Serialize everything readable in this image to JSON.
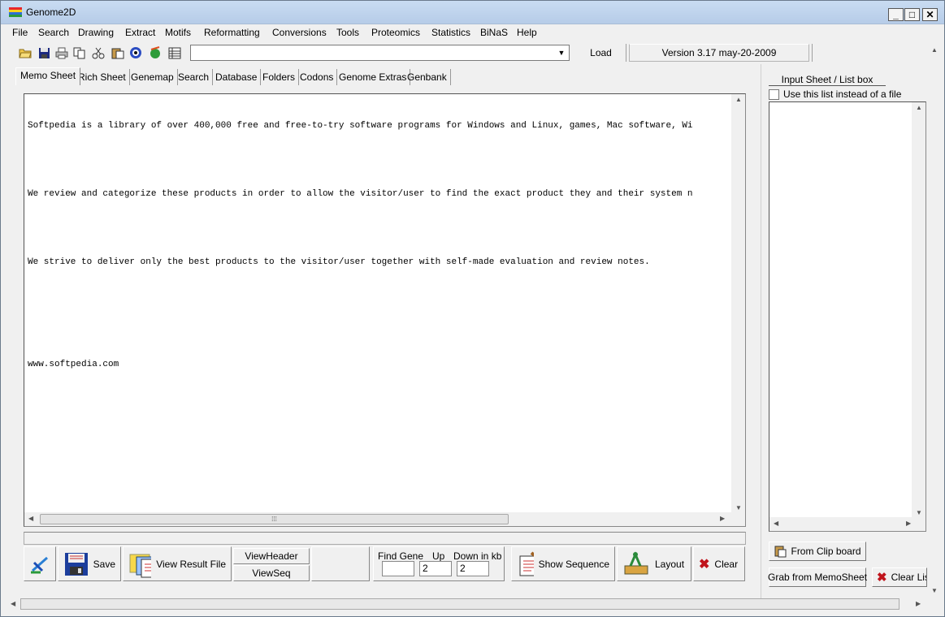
{
  "window": {
    "title": "Genome2D"
  },
  "menu": [
    "File",
    "Search",
    "Drawing",
    "Extract",
    "Motifs",
    "Reformatting",
    "Conversions",
    "Tools",
    "Proteomics",
    "Statistics",
    "BiNaS",
    "Help"
  ],
  "toolbar": {
    "combo_value": "",
    "load_label": "Load",
    "version": "Version 3.17   may-20-2009"
  },
  "tabs": [
    "Memo Sheet",
    "Rich Sheet",
    "Genemap",
    "Search",
    "Database",
    "Folders",
    "Codons",
    "Genome Extras",
    "Genbank"
  ],
  "memo": {
    "lines": [
      "Softpedia is a library of over 400,000 free and free-to-try software programs for Windows and Linux, games, Mac software, Wi",
      "",
      "We review and categorize these products in order to allow the visitor/user to find the exact product they and their system n",
      "",
      "We strive to deliver only the best products to the visitor/user together with self-made evaluation and review notes.",
      "",
      "",
      "www.softpedia.com"
    ]
  },
  "bottom": {
    "save_label": "Save",
    "view_result_label": "View Result File",
    "view_header_label": "ViewHeader",
    "view_seq_label": "ViewSeq",
    "find_gene_label": "Find Gene",
    "up_label": "Up",
    "down_label": "Down in kb",
    "find_gene_value": "",
    "up_value": "2",
    "down_value": "2",
    "show_sequence_label": "Show Sequence",
    "layout_label": "Layout",
    "clear_label": "Clear"
  },
  "right_panel": {
    "title": "Input Sheet / List box",
    "checkbox_label": "Use this list instead of a file",
    "from_clipboard_label": "From Clip board",
    "grab_memo_label": "Grab from MemoSheet",
    "clear_list_label": "Clear List"
  },
  "icons": {
    "title": "genome2d-logo-icon",
    "toolbar": [
      "open-folder-icon",
      "save-disk-icon",
      "print-icon",
      "copy-icon",
      "cut-icon",
      "paste-icon",
      "view-eye-icon",
      "dna-globe-icon",
      "table-icon"
    ]
  },
  "colors": {
    "title_bar": "#c9dcf2",
    "clear_x": "#c0141c"
  }
}
